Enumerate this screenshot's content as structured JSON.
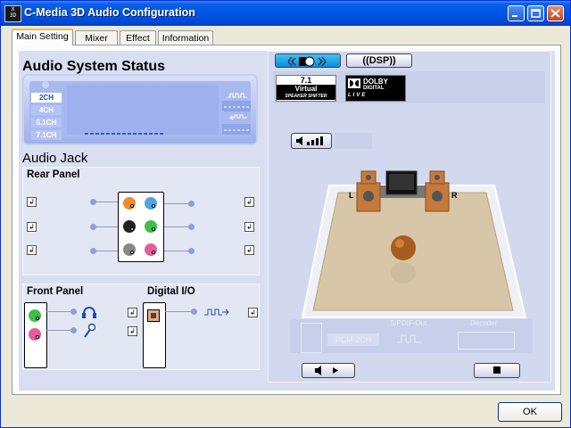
{
  "window": {
    "title": "C-Media 3D Audio Configuration",
    "icon_text": "Xear 3D"
  },
  "tabs": [
    {
      "label": "Main Setting",
      "active": true
    },
    {
      "label": "Mixer",
      "active": false
    },
    {
      "label": "Effect",
      "active": false
    },
    {
      "label": "Information",
      "active": false
    }
  ],
  "status": {
    "heading": "Audio System Status",
    "speaker_modes": [
      "2CH",
      "4CH",
      "5.1CH",
      "7.1CH"
    ],
    "active_mode": "2CH"
  },
  "audio_jack": {
    "heading": "Audio Jack",
    "rear_panel": "Rear Panel",
    "front_panel": "Front Panel",
    "digital_io": "Digital I/O"
  },
  "toolbar": {
    "dsp_label": "DSP",
    "virtual_logo": {
      "top": "7.1",
      "middle": "Virtual",
      "bottom": "SPEAKER SHIFTER"
    },
    "dolby_logo": {
      "line1": "DOLBY",
      "line2": "DIGITAL",
      "line3": "LIVE"
    }
  },
  "stage": {
    "left_label": "L",
    "right_label": "R"
  },
  "spdif": {
    "status": "PCM 2CH",
    "out_label": "S/PDIF-Out",
    "decoder_label": "Decoder"
  },
  "buttons": {
    "ok": "OK"
  },
  "colors": {
    "title_bar": "#0055E5",
    "panel_bg": "#D9DEF0",
    "tab_highlight": "#F7B84A"
  }
}
